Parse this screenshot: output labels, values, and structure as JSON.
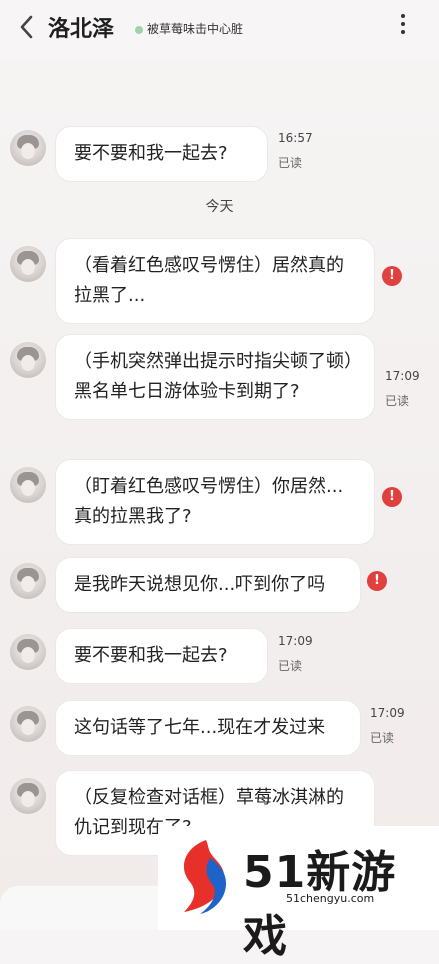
{
  "header": {
    "title": "洛北泽",
    "status": "被草莓味击中心脏"
  },
  "date_divider": "今天",
  "messages": [
    {
      "text": "要不要和我一起去?",
      "time": "16:57",
      "read": "已读"
    },
    {
      "text": "（看着红色感叹号愣住）居然真的拉黑了...",
      "failed": true
    },
    {
      "text": "（手机突然弹出提示时指尖顿了顿）黑名单七日游体验卡到期了?",
      "time": "17:09",
      "read": "已读"
    },
    {
      "text": "（盯着红色感叹号愣住）你居然...真的拉黑我了?",
      "failed": true
    },
    {
      "text": "是我昨天说想见你...吓到你了吗",
      "failed": true
    },
    {
      "text": "要不要和我一起去?",
      "time": "17:09",
      "read": "已读"
    },
    {
      "text": "这句话等了七年...现在才发过来",
      "time": "17:09",
      "read": "已读"
    },
    {
      "text": "（反复检查对话框）草莓冰淇淋的仇记到现在了?"
    }
  ],
  "watermark": {
    "brand": "51新游戏",
    "url": "51chengyu.com"
  },
  "colors": {
    "error": "#e0403e",
    "online": "#9fd4a7"
  }
}
